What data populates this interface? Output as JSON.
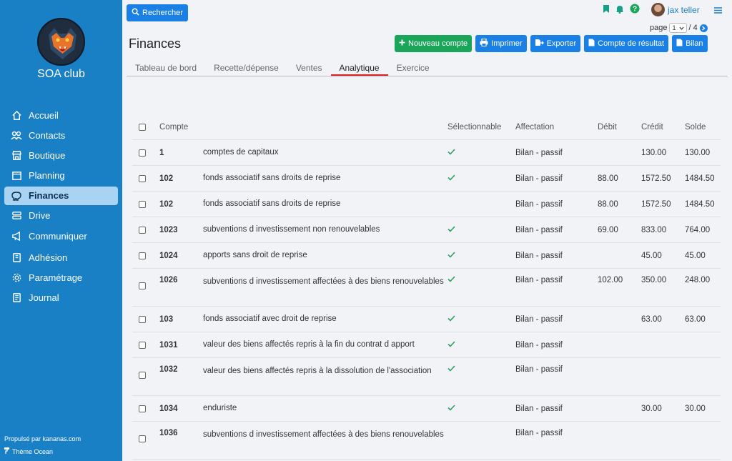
{
  "sidebar": {
    "club_name": "SOA club",
    "items": [
      {
        "label": "Accueil",
        "icon": "home-icon"
      },
      {
        "label": "Contacts",
        "icon": "users-icon"
      },
      {
        "label": "Boutique",
        "icon": "store-icon"
      },
      {
        "label": "Planning",
        "icon": "calendar-icon"
      },
      {
        "label": "Finances",
        "icon": "piggy-bank-icon",
        "active": true
      },
      {
        "label": "Drive",
        "icon": "drive-icon"
      },
      {
        "label": "Communiquer",
        "icon": "megaphone-icon"
      },
      {
        "label": "Adhésion",
        "icon": "id-card-icon"
      },
      {
        "label": "Paramétrage",
        "icon": "gear-icon"
      },
      {
        "label": "Journal",
        "icon": "journal-icon"
      }
    ],
    "powered_by": "Propulsé par kananas.com",
    "theme": "Thème Ocean"
  },
  "topbar": {
    "search_label": "Rechercher",
    "user_name": "jax teller",
    "page_label": "page",
    "page_current": "1",
    "page_total": "/ 4"
  },
  "page": {
    "title": "Finances",
    "actions": {
      "new_account": "Nouveau compte",
      "print": "Imprimer",
      "export": "Exporter",
      "income_statement": "Compte de résultat",
      "balance": "Bilan"
    },
    "tabs": [
      "Tableau de bord",
      "Recette/dépense",
      "Ventes",
      "Analytique",
      "Exercice"
    ],
    "active_tab": "Analytique"
  },
  "table": {
    "headers": {
      "compte": "Compte",
      "selectable": "Sélectionnable",
      "affectation": "Affectation",
      "debit": "Débit",
      "credit": "Crédit",
      "solde": "Solde"
    },
    "rows": [
      {
        "num": "1",
        "label": "comptes de capitaux",
        "selectable": true,
        "affectation": "Bilan - passif",
        "debit": "",
        "credit": "130.00",
        "solde": "130.00"
      },
      {
        "num": "102",
        "label": "fonds associatif sans droits de reprise",
        "selectable": true,
        "affectation": "Bilan - passif",
        "debit": "88.00",
        "credit": "1572.50",
        "solde": "1484.50"
      },
      {
        "num": "102",
        "label": "fonds associatif sans droits de reprise",
        "selectable": false,
        "affectation": "Bilan - passif",
        "debit": "88.00",
        "credit": "1572.50",
        "solde": "1484.50"
      },
      {
        "num": "1023",
        "label": "subventions d investissement non renouvelables",
        "selectable": true,
        "affectation": "Bilan - passif",
        "debit": "69.00",
        "credit": "833.00",
        "solde": "764.00"
      },
      {
        "num": "1024",
        "label": "apports sans droit de reprise",
        "selectable": true,
        "affectation": "Bilan - passif",
        "debit": "",
        "credit": "45.00",
        "solde": "45.00"
      },
      {
        "num": "1026",
        "label": "subventions d investissement affectées à des biens renouvelables",
        "selectable": true,
        "affectation": "Bilan - passif",
        "debit": "102.00",
        "credit": "350.00",
        "solde": "248.00"
      },
      {
        "num": "103",
        "label": "fonds associatif avec droit de reprise",
        "selectable": true,
        "affectation": "Bilan - passif",
        "debit": "",
        "credit": "63.00",
        "solde": "63.00"
      },
      {
        "num": "1031",
        "label": "valeur des biens affectés repris à la fin du contrat d apport",
        "selectable": true,
        "affectation": "Bilan - passif",
        "debit": "",
        "credit": "",
        "solde": ""
      },
      {
        "num": "1032",
        "label": "valeur des biens affectés repris à la dissolution de l'association",
        "selectable": true,
        "affectation": "Bilan - passif",
        "debit": "",
        "credit": "",
        "solde": ""
      },
      {
        "num": "1034",
        "label": "enduriste",
        "selectable": true,
        "affectation": "Bilan - passif",
        "debit": "",
        "credit": "30.00",
        "solde": "30.00"
      },
      {
        "num": "1036",
        "label": "subventions d investissement affectées à des biens renouvelables",
        "selectable": false,
        "affectation": "Bilan - passif",
        "debit": "",
        "credit": "",
        "solde": ""
      }
    ]
  },
  "colors": {
    "sidebar": "#1a80c6",
    "primary": "#1a80e6",
    "success": "#1aa55a",
    "tab_active": "#e02020",
    "check": "#2aa35a"
  }
}
